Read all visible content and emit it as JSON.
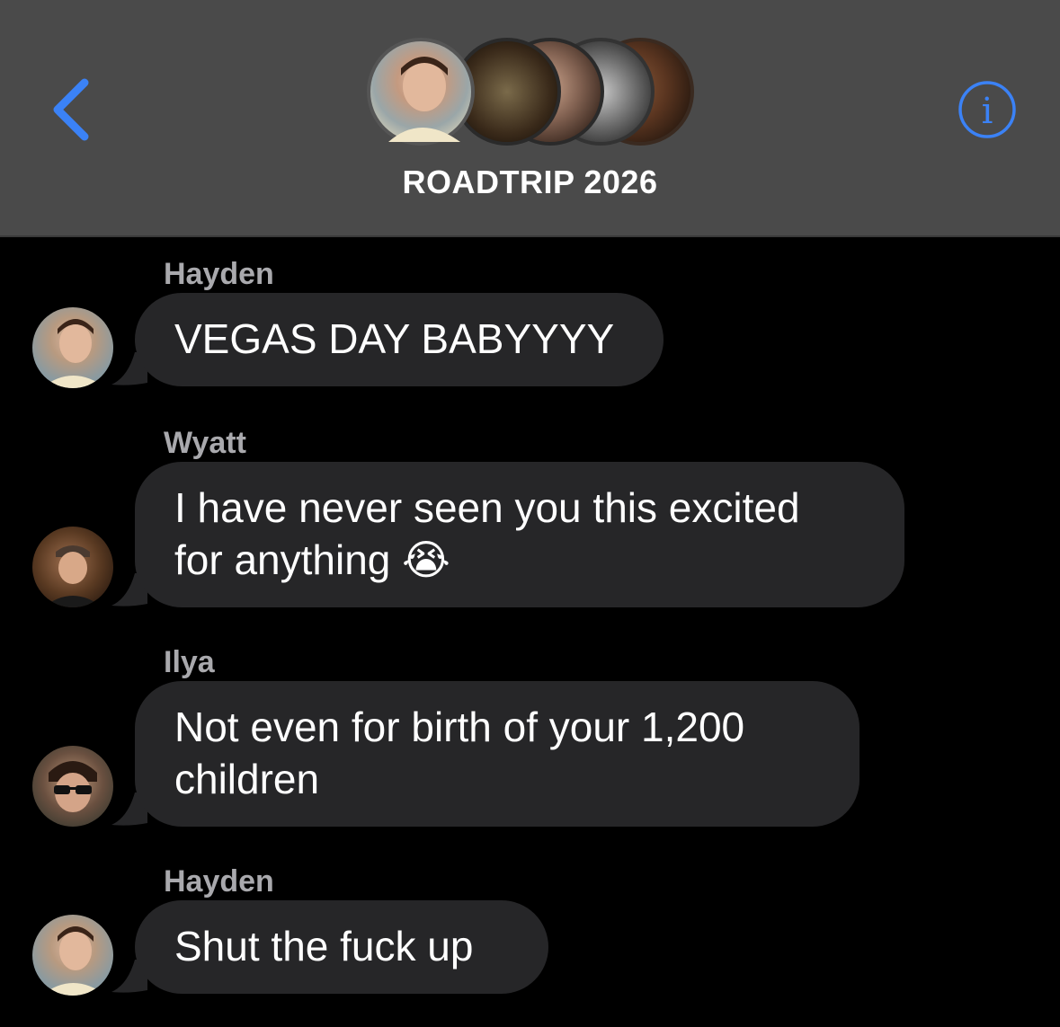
{
  "header": {
    "title": "ROADTRIP 2026",
    "back_icon": "chevron-left-icon",
    "info_icon": "info-circle-icon",
    "accent_color": "#3b82f6",
    "background_color": "#4a4a4a"
  },
  "messages": [
    {
      "sender": "Hayden",
      "text": "VEGAS DAY BABYYYY"
    },
    {
      "sender": "Wyatt",
      "text_line1": "I have never seen you this excited",
      "text_line2": "for anything",
      "emoji": "😭"
    },
    {
      "sender": "Ilya",
      "text_line1": "Not even for birth of your 1,200",
      "text_line2": "children"
    },
    {
      "sender": "Hayden",
      "text": "Shut the fuck up"
    }
  ],
  "colors": {
    "bubble": "#262628",
    "sender_name": "#a9a9ad",
    "background": "#000000"
  }
}
